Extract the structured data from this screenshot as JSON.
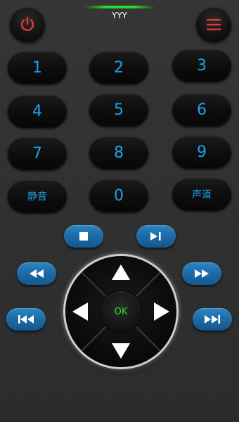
{
  "header": {
    "title": "YYY"
  },
  "top": {
    "power_icon": "power-icon",
    "menu_icon": "menu-icon",
    "power_color": "#e53935",
    "menu_color": "#e53935"
  },
  "keypad": {
    "k1": "1",
    "k2": "2",
    "k3": "3",
    "k4": "4",
    "k5": "5",
    "k6": "6",
    "k7": "7",
    "k8": "8",
    "k9": "9",
    "mute": "静音",
    "k0": "0",
    "channel": "声道"
  },
  "dpad": {
    "ok": "OK"
  },
  "colors": {
    "digit": "#1aa3e6",
    "ok": "#29e029",
    "pill": "#1c6aa6"
  }
}
